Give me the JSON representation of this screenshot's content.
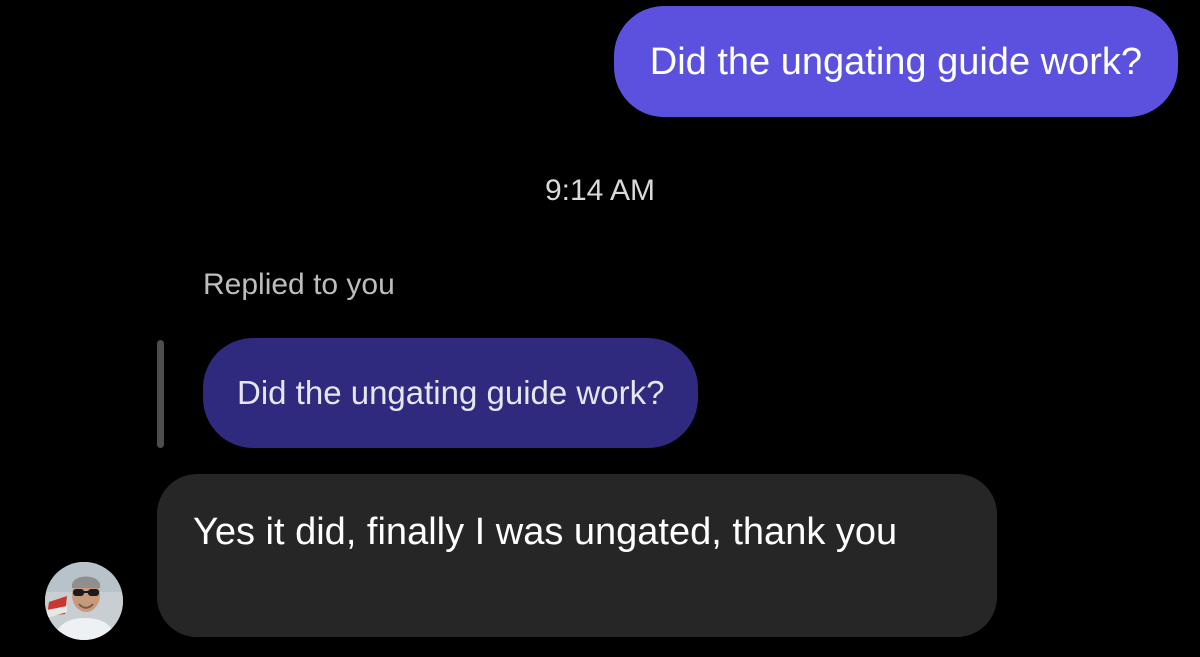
{
  "thread": {
    "outgoing_message": "Did the ungating guide work?",
    "timestamp": "9:14 AM",
    "reply_label": "Replied to you",
    "quoted_message": "Did the ungating guide work?",
    "incoming_message": "Yes it did, finally I was ungated, thank you",
    "avatar_icon": "person-avatar-icon"
  },
  "colors": {
    "background": "#000000",
    "outgoing_bubble": "#5b51de",
    "quoted_bubble": "#2f2a7e",
    "incoming_bubble": "#262626",
    "meta_text": "#bdbdbd"
  }
}
